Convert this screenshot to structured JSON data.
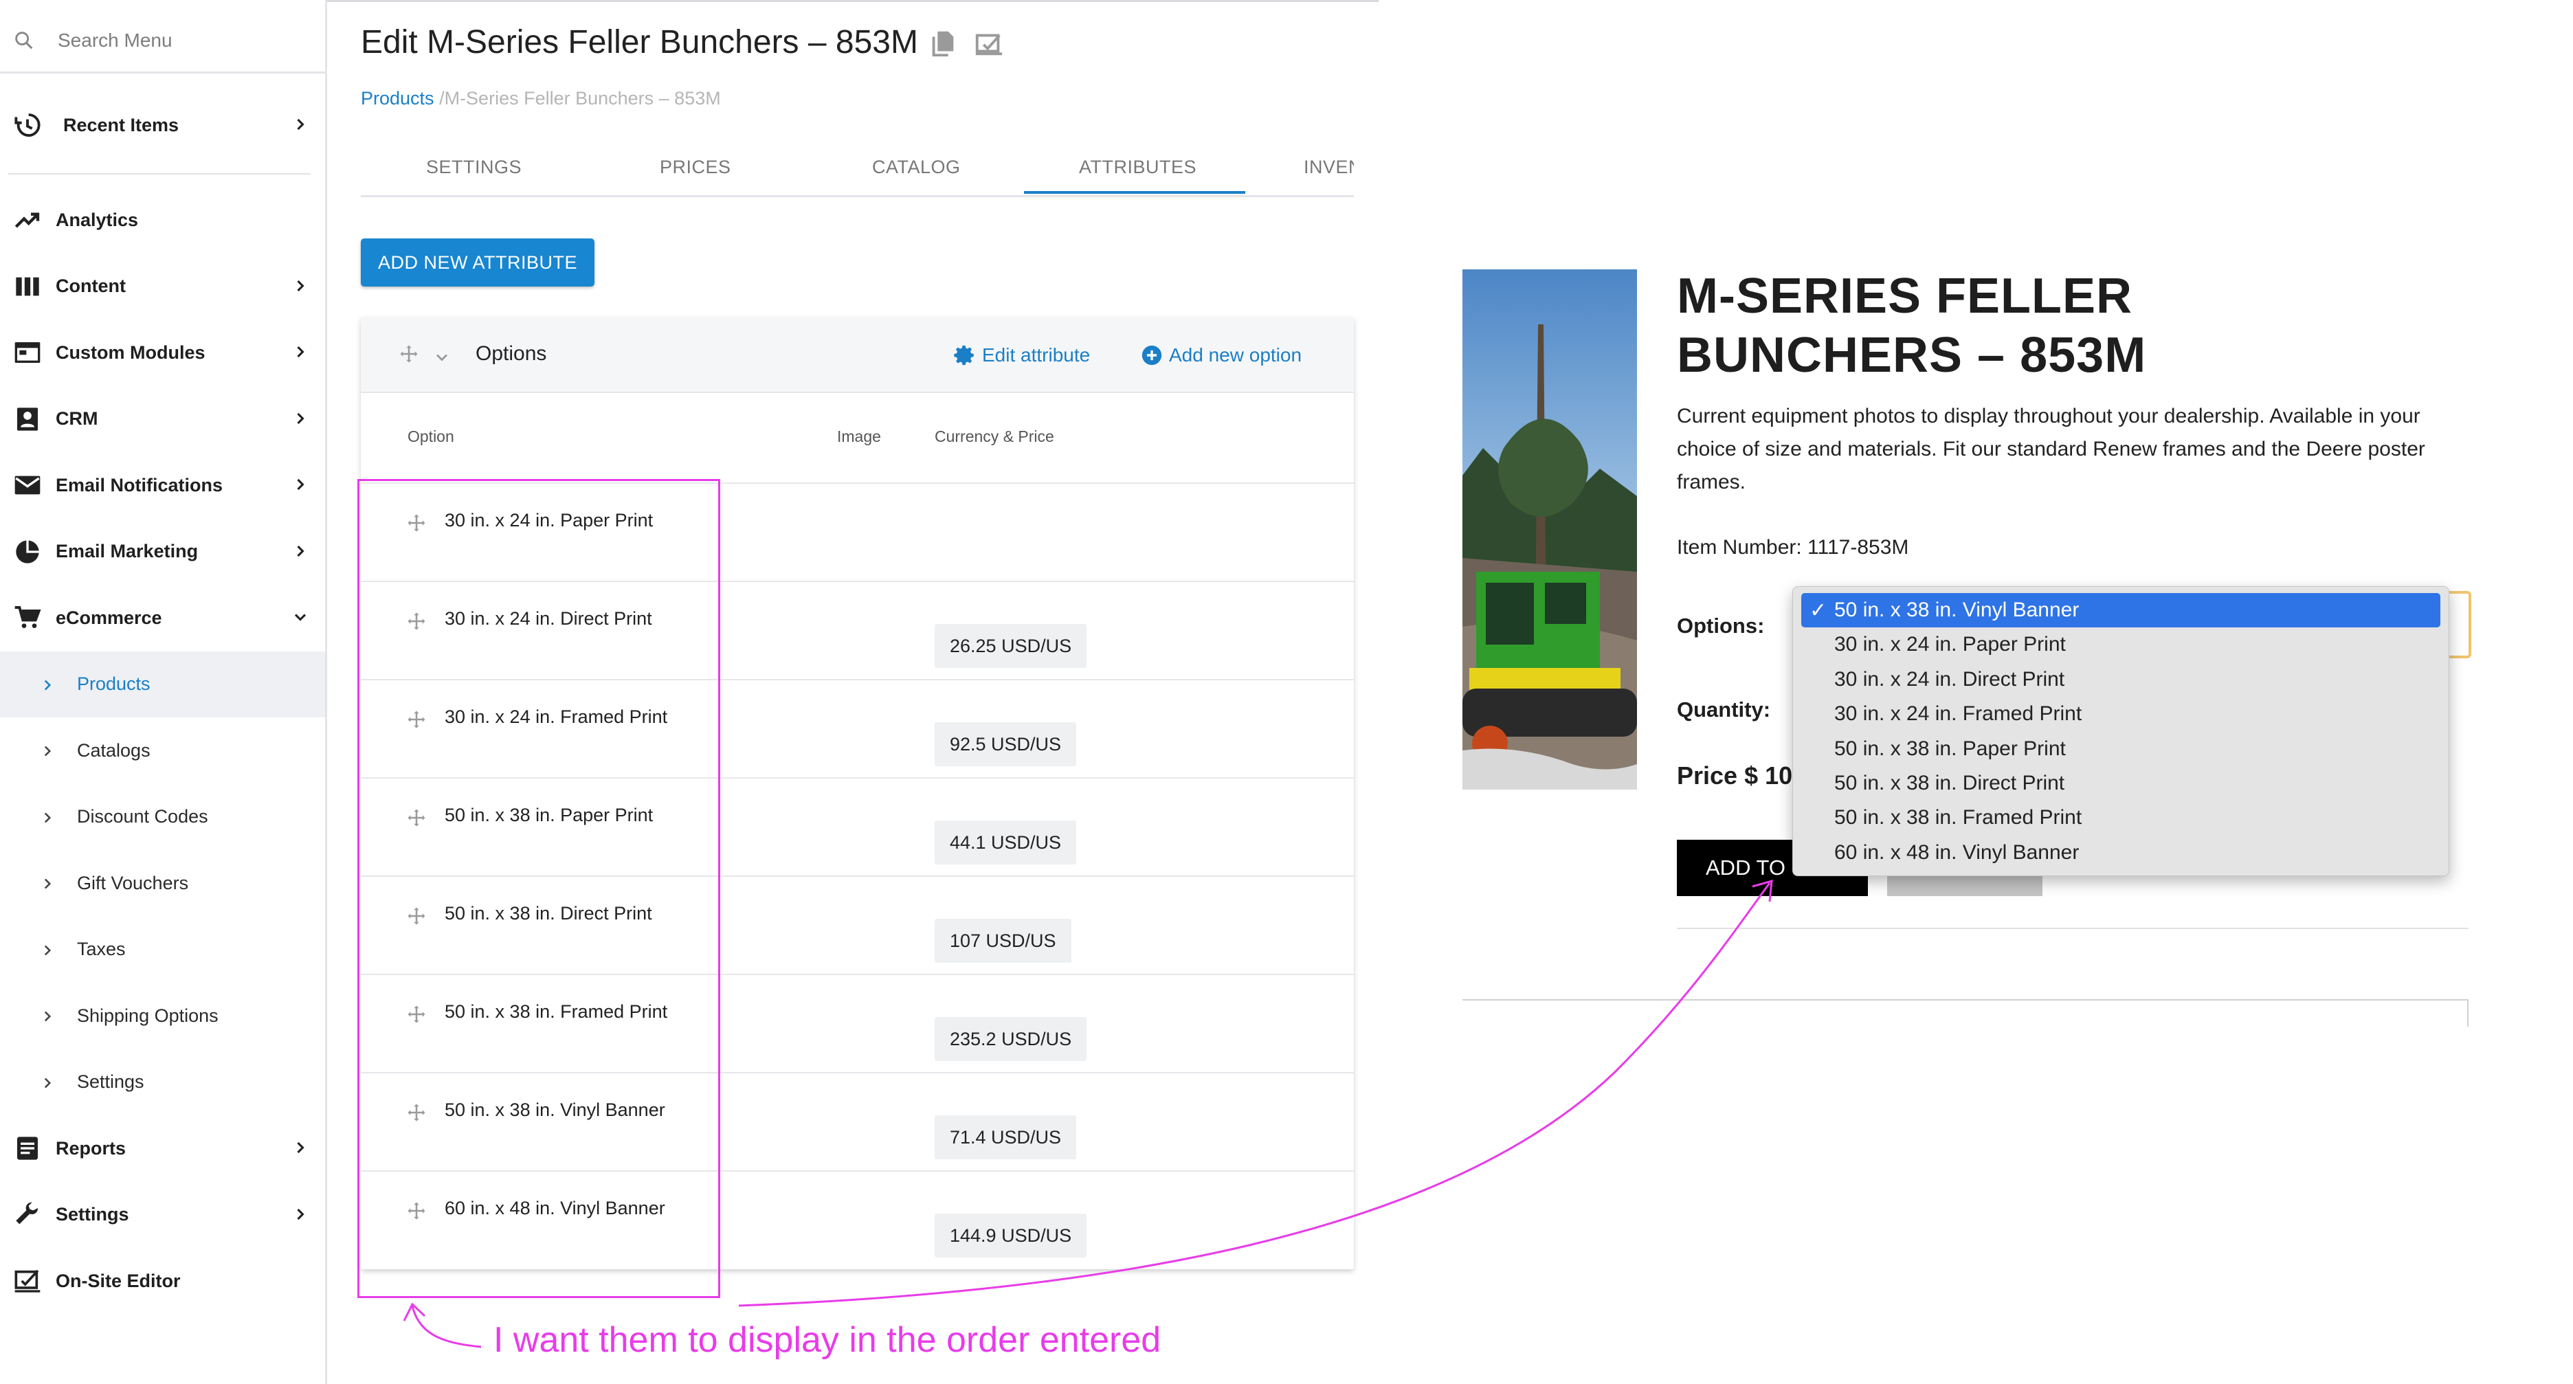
{
  "colors": {
    "accent": "#1a7fc7",
    "primary_button": "#1886d0",
    "annotation": "#e83ce8",
    "dropdown_selected": "#2f74e6",
    "select_focus": "#f0c46d"
  },
  "sidebar": {
    "search_placeholder": "Search Menu",
    "recent": {
      "label": "Recent Items",
      "icon": "history-icon"
    },
    "items": [
      {
        "label": "Analytics",
        "icon": "trending-up-icon",
        "has_children": false
      },
      {
        "label": "Content",
        "icon": "columns-icon",
        "has_children": true
      },
      {
        "label": "Custom Modules",
        "icon": "modules-icon",
        "has_children": true
      },
      {
        "label": "CRM",
        "icon": "contact-card-icon",
        "has_children": true
      },
      {
        "label": "Email Notifications",
        "icon": "mail-icon",
        "has_children": true
      },
      {
        "label": "Email Marketing",
        "icon": "pie-chart-icon",
        "has_children": true
      },
      {
        "label": "eCommerce",
        "icon": "cart-icon",
        "has_children": true,
        "expanded": true
      }
    ],
    "ecommerce_children": [
      "Products",
      "Catalogs",
      "Discount Codes",
      "Gift Vouchers",
      "Taxes",
      "Shipping Options",
      "Settings"
    ],
    "active_child": "Products",
    "bottom_items": [
      {
        "label": "Reports",
        "icon": "report-icon",
        "has_children": true
      },
      {
        "label": "Settings",
        "icon": "wrench-icon",
        "has_children": true
      },
      {
        "label": "On-Site Editor",
        "icon": "editor-icon",
        "has_children": false
      }
    ]
  },
  "editor": {
    "title": "Edit M-Series Feller Bunchers – 853M",
    "breadcrumb": {
      "link": "Products",
      "current": " /M-Series Feller Bunchers – 853M"
    },
    "tabs": [
      "SETTINGS",
      "PRICES",
      "CATALOG",
      "ATTRIBUTES",
      "INVEN"
    ],
    "active_tab": "ATTRIBUTES",
    "add_attribute_label": "ADD NEW ATTRIBUTE",
    "attribute": {
      "name": "Options",
      "edit_label": "Edit attribute",
      "add_option_label": "Add new option",
      "columns": [
        "Option",
        "Image",
        "Currency & Price"
      ],
      "rows": [
        {
          "option": "30 in. x 24 in. Paper Print",
          "price": ""
        },
        {
          "option": "30 in. x 24 in. Direct Print",
          "price": "26.25 USD/US"
        },
        {
          "option": "30 in. x 24 in. Framed Print",
          "price": "92.5 USD/US"
        },
        {
          "option": "50 in. x 38 in. Paper Print",
          "price": "44.1 USD/US"
        },
        {
          "option": "50 in. x 38 in. Direct Print",
          "price": "107 USD/US"
        },
        {
          "option": "50 in. x 38 in. Framed Print",
          "price": "235.2 USD/US"
        },
        {
          "option": "50 in. x 38 in. Vinyl Banner",
          "price": "71.4 USD/US"
        },
        {
          "option": "60 in. x 48 in. Vinyl Banner",
          "price": "144.9 USD/US"
        }
      ]
    }
  },
  "storefront": {
    "title": "M-SERIES FELLER BUNCHERS – 853M",
    "description": "Current equipment photos to display throughout your dealership. Available in your choice of size and materials. Fit our standard Renew frames and the Deere poster frames.",
    "item_number": "Item Number: 1117-853M",
    "options_label": "Options:",
    "quantity_label": "Quantity:",
    "price_label": "Price $ 10",
    "add_button": "ADD TO",
    "dropdown": {
      "checkmark": "✓",
      "selected": "50 in. x 38 in. Vinyl Banner",
      "options": [
        "50 in. x 38 in. Vinyl Banner",
        "30 in. x 24 in. Paper Print",
        "30 in. x 24 in. Direct Print",
        "30 in. x 24 in. Framed Print",
        "50 in. x 38 in. Paper Print",
        "50 in. x 38 in. Direct Print",
        "50 in. x 38 in. Framed Print",
        "60 in. x 48 in. Vinyl Banner"
      ]
    }
  },
  "annotation": {
    "text": "I want them to display in the order entered"
  }
}
